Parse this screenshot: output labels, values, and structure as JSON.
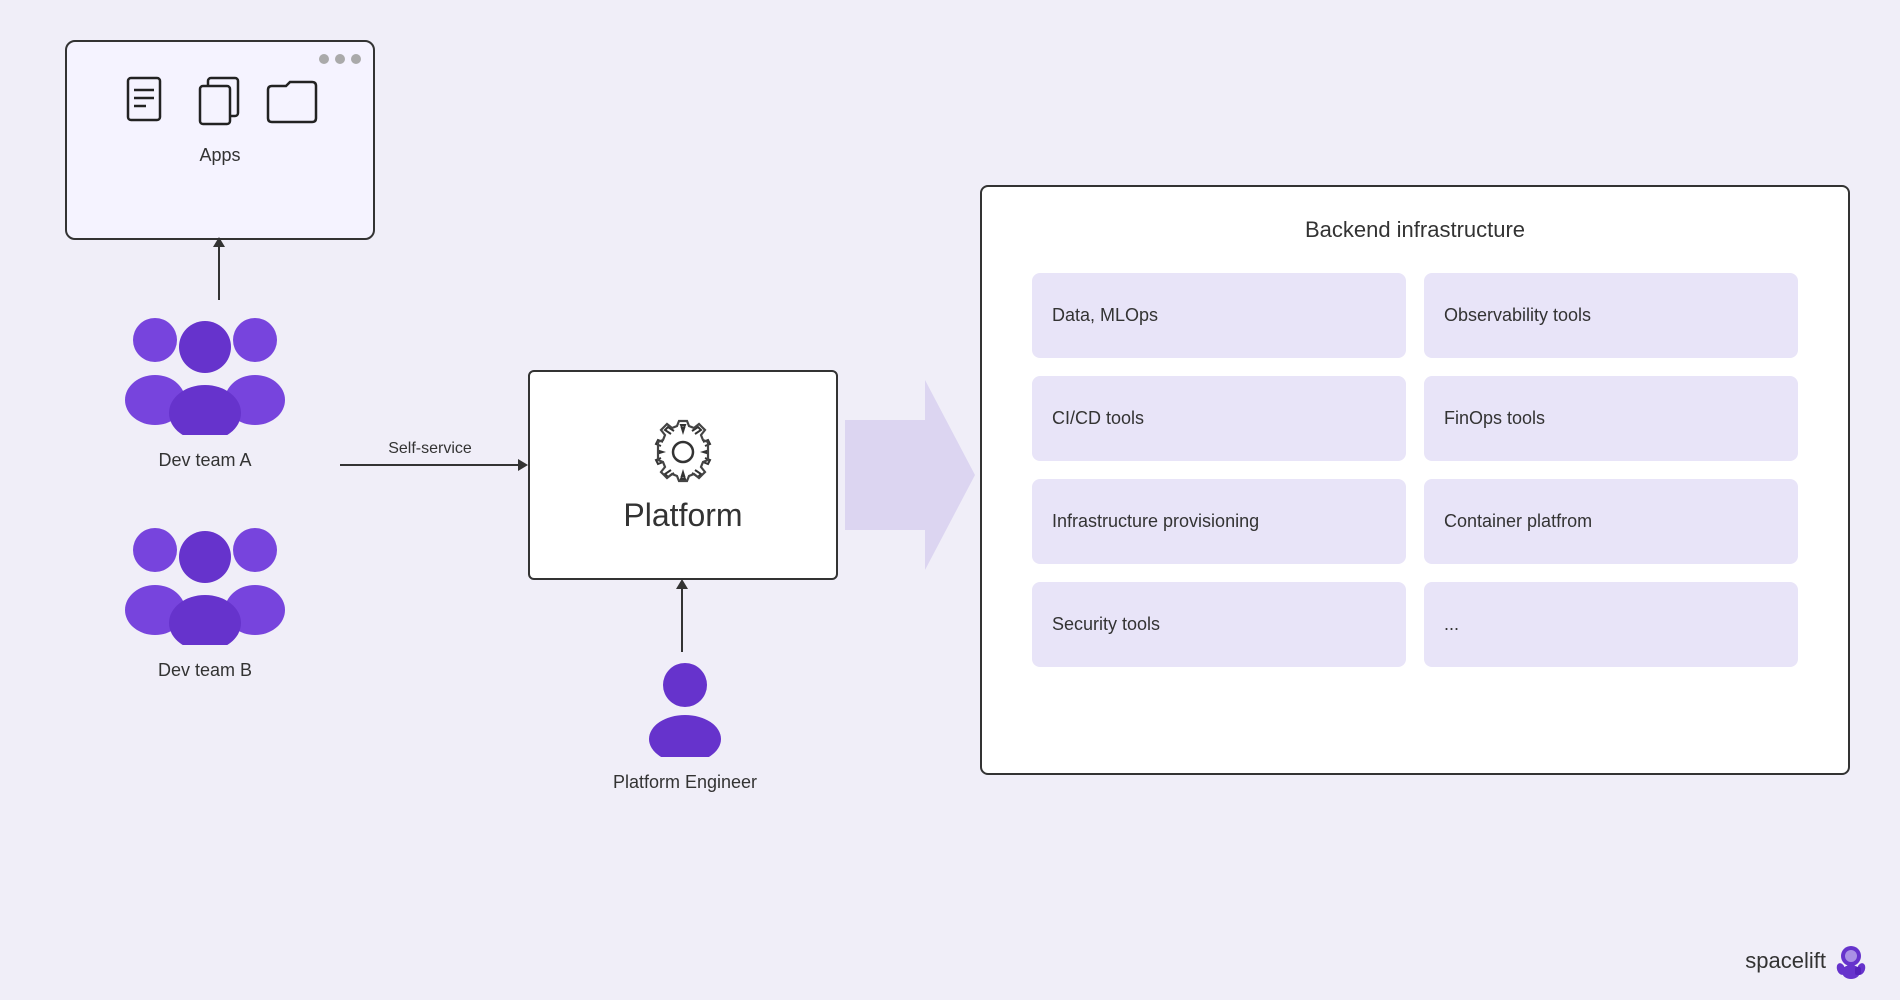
{
  "apps": {
    "label": "Apps",
    "window_dots": [
      "dot1",
      "dot2",
      "dot3"
    ]
  },
  "dev_team_a": {
    "label": "Dev team A"
  },
  "dev_team_b": {
    "label": "Dev team B"
  },
  "self_service": {
    "label": "Self-service"
  },
  "platform": {
    "label": "Platform"
  },
  "platform_engineer": {
    "label": "Platform Engineer"
  },
  "backend": {
    "title": "Backend infrastructure",
    "items": [
      {
        "label": "Data, MLOps"
      },
      {
        "label": "Observability tools"
      },
      {
        "label": "CI/CD tools"
      },
      {
        "label": "FinOps tools"
      },
      {
        "label": "Infrastructure provisioning"
      },
      {
        "label": "Container platfrom"
      },
      {
        "label": "Security tools"
      },
      {
        "label": "..."
      }
    ]
  },
  "brand": {
    "name": "spacelift"
  }
}
